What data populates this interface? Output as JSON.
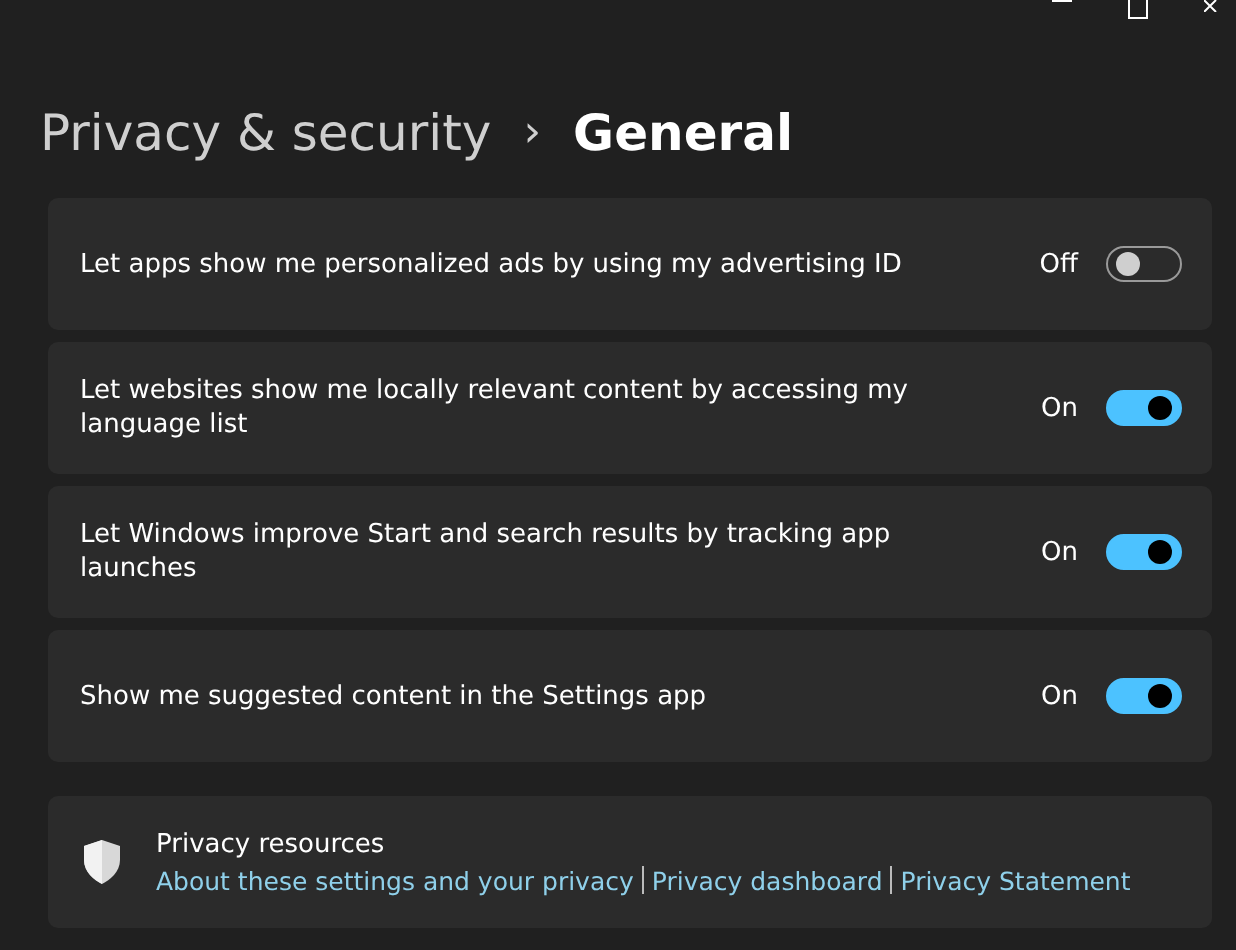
{
  "breadcrumb": {
    "parent": "Privacy & security",
    "separator": "›",
    "current": "General"
  },
  "settings": [
    {
      "label": "Let apps show me personalized ads by using my advertising ID",
      "state_label": "Off",
      "on": false
    },
    {
      "label": "Let websites show me locally relevant content by accessing my language list",
      "state_label": "On",
      "on": true
    },
    {
      "label": "Let Windows improve Start and search results by tracking app launches",
      "state_label": "On",
      "on": true
    },
    {
      "label": "Show me suggested content in the Settings app",
      "state_label": "On",
      "on": true
    }
  ],
  "resources": {
    "title": "Privacy resources",
    "links": [
      "About these settings and your privacy",
      "Privacy dashboard",
      "Privacy Statement"
    ]
  }
}
